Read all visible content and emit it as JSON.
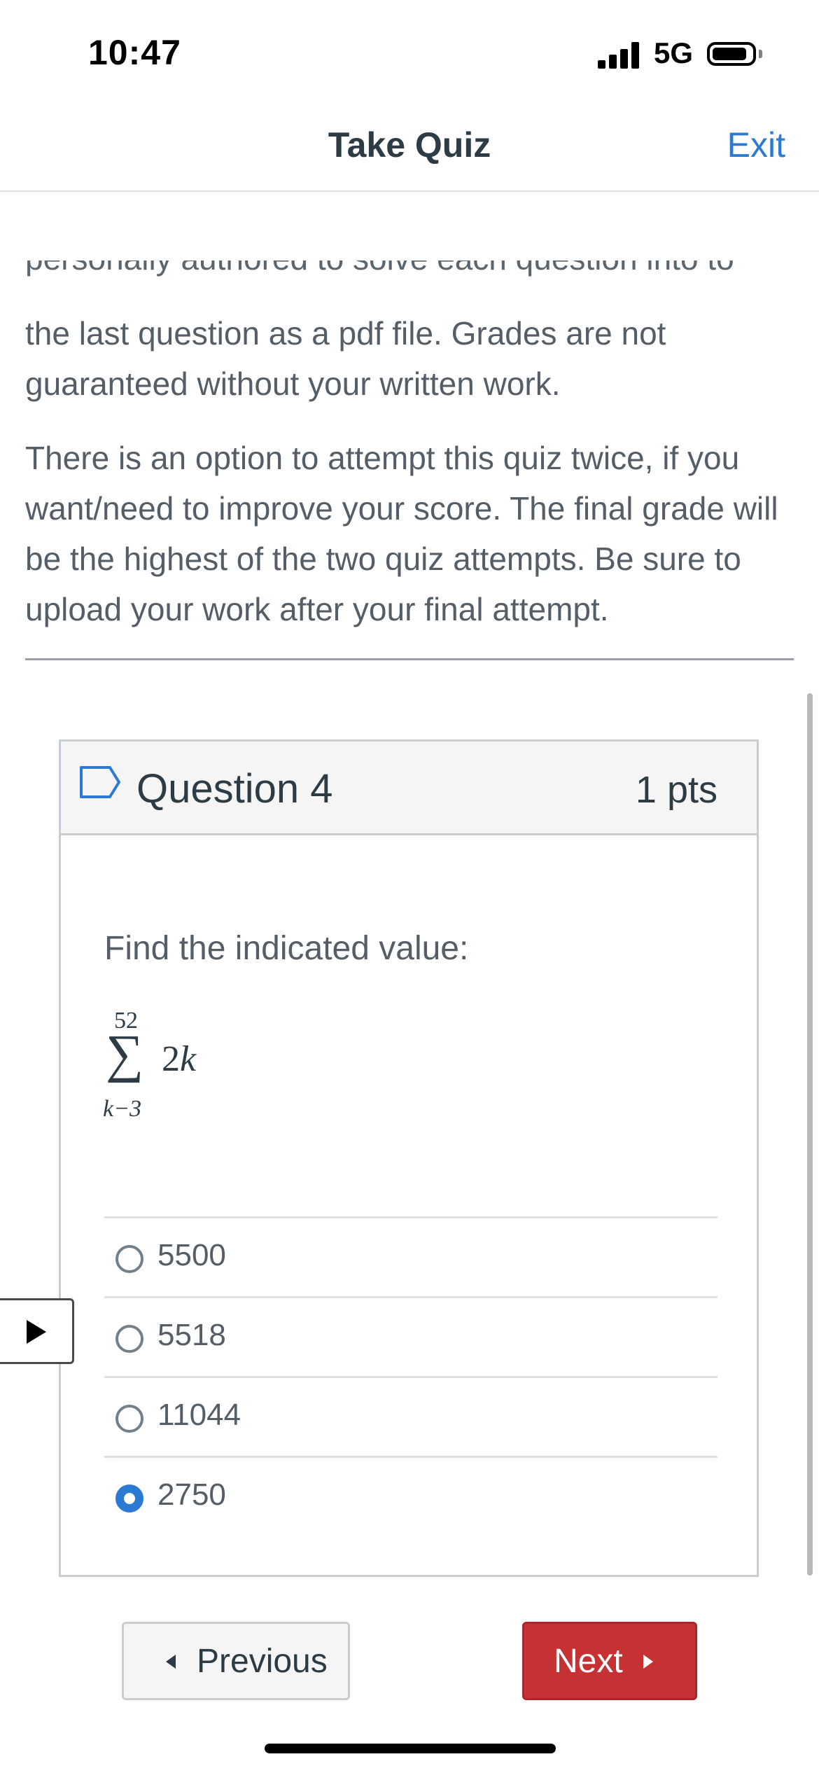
{
  "status_bar": {
    "time": "10:47",
    "network": "5G"
  },
  "nav": {
    "title": "Take Quiz",
    "exit_label": "Exit"
  },
  "instructions": {
    "clipped_line": "personally authored to solve each question into to",
    "paragraph1": "the last question as a pdf file.  Grades are not guaranteed without your written work.",
    "paragraph2": "There is an option to attempt this quiz twice, if you want/need to improve your score.  The final grade will be the highest of the two quiz attempts.  Be sure to upload your work after your final attempt."
  },
  "question": {
    "title": "Question 4",
    "points": "1 pts",
    "prompt": "Find the indicated value:",
    "math": {
      "upper": "52",
      "symbol": "∑",
      "coefficient": "2",
      "variable": "k",
      "lower": "k−3"
    },
    "answers": [
      {
        "label": "5500",
        "selected": false
      },
      {
        "label": "5518",
        "selected": false
      },
      {
        "label": "11044",
        "selected": false
      },
      {
        "label": "2750",
        "selected": true
      }
    ]
  },
  "footer": {
    "previous_label": "Previous",
    "next_label": "Next"
  },
  "colors": {
    "accent": "#2b7bd4",
    "next_button": "#c63134"
  }
}
